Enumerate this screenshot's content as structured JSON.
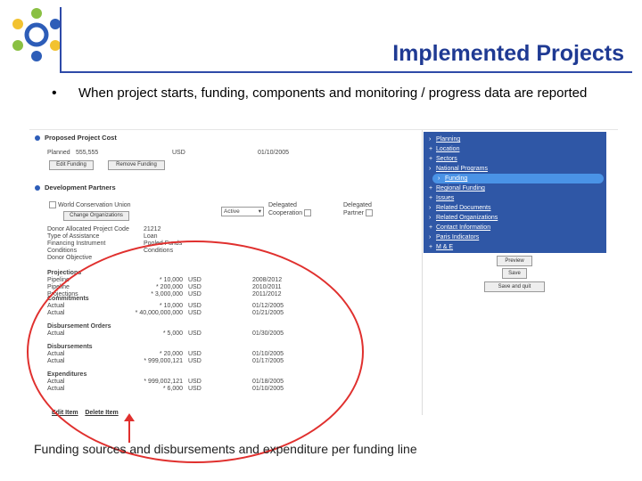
{
  "header": {
    "title": "Implemented Projects",
    "bullet": "•",
    "bullet_text": "When project starts, funding, components and monitoring / progress data are reported"
  },
  "screenshot": {
    "proposed_cost": {
      "heading": "Proposed Project Cost",
      "planned_label": "Planned",
      "planned_value": "555,555",
      "currency": "USD",
      "date": "01/10/2005",
      "add_button": "Edit Funding",
      "remove_button": "Remove Funding"
    },
    "partners": {
      "heading": "Development Partners",
      "org_name": "World Conservation Union",
      "org_button": "Change Organizations",
      "status": "Active",
      "delegated_coop": "Delegated Cooperation",
      "delegated_partner": "Delegated Partner",
      "details": [
        {
          "label": "Donor Allocated Project Code",
          "value": "21212"
        },
        {
          "label": "Type of Assistance",
          "value": "Loan"
        },
        {
          "label": "Financing Instrument",
          "value": "Pooled Funds"
        },
        {
          "label": "Conditions",
          "value": "Conditions"
        },
        {
          "label": "Donor Objective",
          "value": ""
        }
      ]
    },
    "projections": {
      "heading": "Projections",
      "rows": [
        {
          "type": "Pipeline",
          "amount": "* 10,000",
          "currency": "USD",
          "date": "2008/2012"
        },
        {
          "type": "Pipeline",
          "amount": "* 200,000",
          "currency": "USD",
          "date": "2010/2011"
        },
        {
          "type": "Projections",
          "amount": "* 3,000,000",
          "currency": "USD",
          "date": "2011/2012"
        }
      ]
    },
    "commitments": {
      "heading": "Commitments",
      "rows": [
        {
          "type": "Actual",
          "amount": "* 10,000",
          "currency": "USD",
          "date": "01/12/2005"
        },
        {
          "type": "Actual",
          "amount": "* 40,000,000,000",
          "currency": "USD",
          "date": "01/21/2005"
        }
      ]
    },
    "disbursement_orders": {
      "heading": "Disbursement Orders",
      "rows": [
        {
          "type": "Actual",
          "amount": "* 5,000",
          "currency": "USD",
          "date": "01/30/2005"
        }
      ]
    },
    "disbursements": {
      "heading": "Disbursements",
      "rows": [
        {
          "type": "Actual",
          "amount": "* 20,000",
          "currency": "USD",
          "date": "01/10/2005"
        },
        {
          "type": "Actual",
          "amount": "* 999,000,121",
          "currency": "USD",
          "date": "01/17/2005"
        }
      ]
    },
    "expenditures": {
      "heading": "Expenditures",
      "rows": [
        {
          "type": "Actual",
          "amount": "* 999,002,121",
          "currency": "USD",
          "date": "01/18/2005"
        },
        {
          "type": "Actual",
          "amount": "* 6,000",
          "currency": "USD",
          "date": "01/10/2005"
        }
      ]
    },
    "links": {
      "edit": "Edit Item",
      "delete": "Delete Item"
    },
    "nav": [
      {
        "mark": "›",
        "label": "Planning"
      },
      {
        "mark": "+",
        "label": "Location"
      },
      {
        "mark": "+",
        "label": "Sectors"
      },
      {
        "mark": "›",
        "label": "National Programs"
      },
      {
        "mark": "›",
        "label": "Funding",
        "active": true
      },
      {
        "mark": "+",
        "label": "Regional Funding"
      },
      {
        "mark": "+",
        "label": "Issues"
      },
      {
        "mark": "›",
        "label": "Related Documents"
      },
      {
        "mark": "›",
        "label": "Related Organizations"
      },
      {
        "mark": "+",
        "label": "Contact Information"
      },
      {
        "mark": "›",
        "label": "Paris Indicators"
      },
      {
        "mark": "+",
        "label": "M & E"
      }
    ],
    "side_buttons": {
      "preview": "Preview",
      "save": "Save",
      "save_all": "Save and quit"
    }
  },
  "caption": "Funding sources and disbursements and expenditure per funding line",
  "colors": {
    "title": "#1f3a93",
    "rule": "#2e4aa8",
    "annotation": "#e0302e",
    "nav_bg": "#2f57a6",
    "nav_active": "#4a93e6"
  }
}
